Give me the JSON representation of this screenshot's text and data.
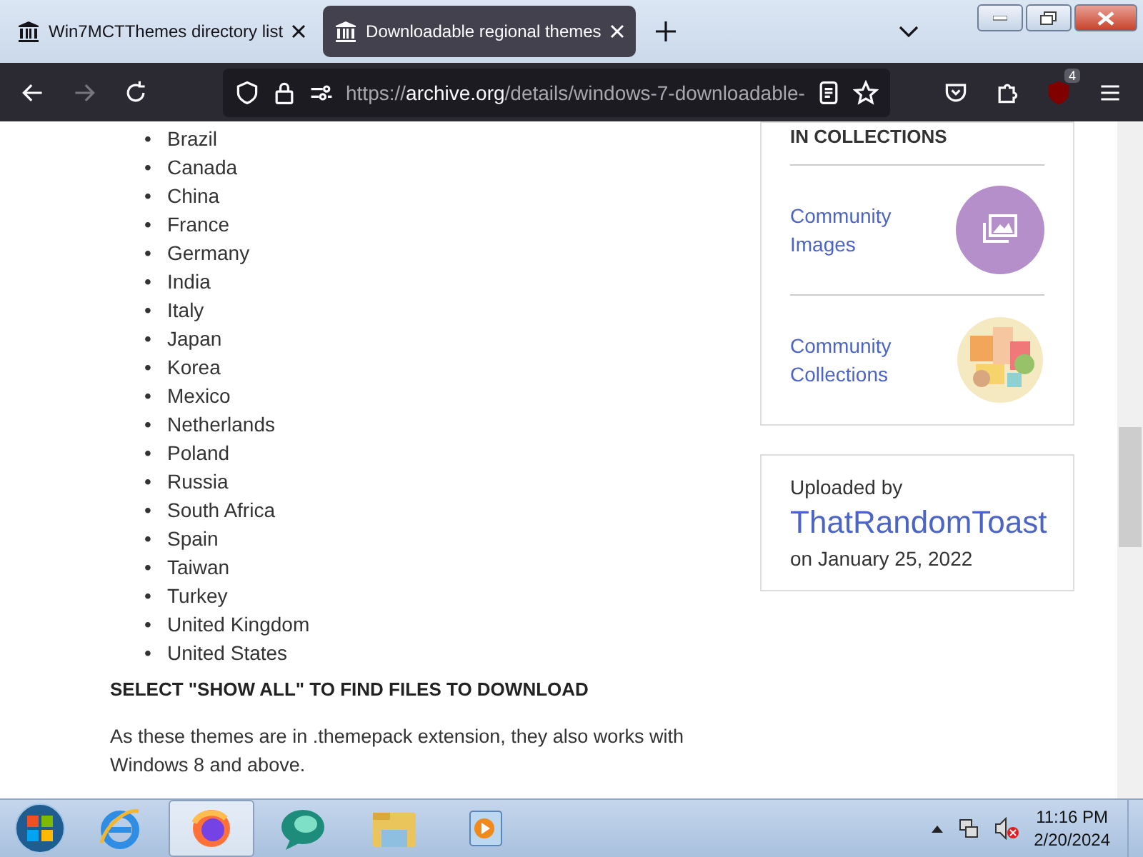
{
  "tabs": [
    {
      "label": "Win7MCTThemes directory list",
      "selected": false
    },
    {
      "label": "Downloadable regional themes",
      "selected": true
    }
  ],
  "address_bar": {
    "url_prefix": "https://",
    "url_domain": "archive.org",
    "url_path": "/details/windows-7-downloadable-"
  },
  "extension_badge": "4",
  "bullet": "•",
  "countries": [
    "Brazil",
    "Canada",
    "China",
    "France",
    "Germany",
    "India",
    "Italy",
    "Japan",
    "Korea",
    "Mexico",
    "Netherlands",
    "Poland",
    "Russia",
    "South Africa",
    "Spain",
    "Taiwan",
    "Turkey",
    "United Kingdom",
    "United States"
  ],
  "download_heading": "SELECT \"SHOW ALL\" TO FIND FILES TO DOWNLOAD",
  "note": "As these themes are in .themepack extension, they also works with Windows 8 and above.",
  "collections": {
    "heading": "IN COLLECTIONS",
    "items": [
      {
        "label": "Community Images",
        "kind": "images"
      },
      {
        "label": "Community Collections",
        "kind": "collections"
      }
    ]
  },
  "uploader": {
    "label": "Uploaded by",
    "name": "ThatRandomToast",
    "date": "on January 25, 2022"
  },
  "taskbar": {
    "apps": [
      {
        "kind": "ie",
        "selected": false
      },
      {
        "kind": "firefox",
        "selected": true
      },
      {
        "kind": "chat",
        "selected": false
      },
      {
        "kind": "explorer",
        "selected": false
      },
      {
        "kind": "media",
        "selected": false
      }
    ],
    "time": "11:16 PM",
    "date": "2/20/2024"
  }
}
